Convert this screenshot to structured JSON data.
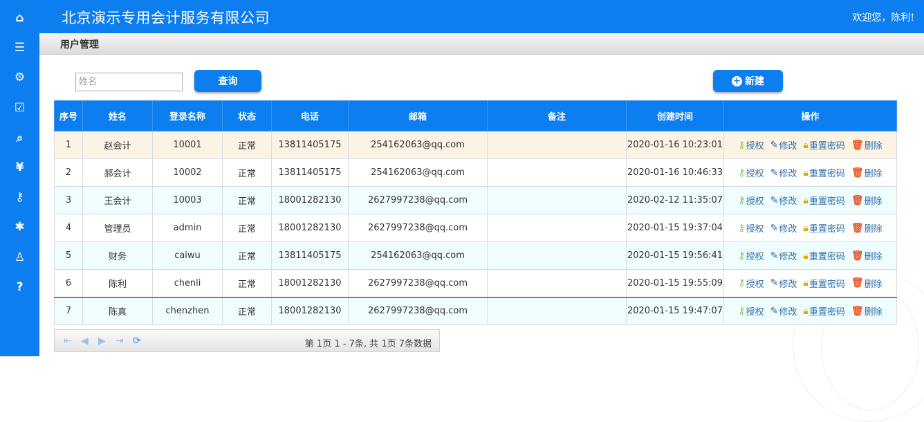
{
  "header": {
    "company": "北京演示专用会计服务有限公司",
    "welcome": "欢迎您，陈利!"
  },
  "sidebar": {
    "icons": [
      "home-icon",
      "list-icon",
      "gears-icon",
      "check-square-icon",
      "search-icon",
      "yen-icon",
      "key-icon",
      "gear-icon",
      "user-icon",
      "question-icon"
    ]
  },
  "breadcrumb": "用户管理",
  "search": {
    "placeholder": "姓名",
    "value": "",
    "button": "查询"
  },
  "toolbar": {
    "new_label": "新建"
  },
  "table": {
    "columns": [
      "序号",
      "姓名",
      "登录名称",
      "状态",
      "电话",
      "邮箱",
      "备注",
      "创建时间",
      "操作"
    ],
    "rows": [
      [
        "1",
        "赵会计",
        "10001",
        "正常",
        "13811405175",
        "254162063@qq.com",
        "",
        "2020-01-16 10:23:01"
      ],
      [
        "2",
        "郝会计",
        "10002",
        "正常",
        "13811405175",
        "254162063@qq.com",
        "",
        "2020-01-16 10:46:33"
      ],
      [
        "3",
        "王会计",
        "10003",
        "正常",
        "18001282130",
        "2627997238@qq.com",
        "",
        "2020-02-12 11:35:07"
      ],
      [
        "4",
        "管理员",
        "admin",
        "正常",
        "18001282130",
        "2627997238@qq.com",
        "",
        "2020-01-15 19:37:04"
      ],
      [
        "5",
        "财务",
        "caiwu",
        "正常",
        "13811405175",
        "254162063@qq.com",
        "",
        "2020-01-15 19:56:41"
      ],
      [
        "6",
        "陈利",
        "chenli",
        "正常",
        "18001282130",
        "2627997238@qq.com",
        "",
        "2020-01-15 19:55:09"
      ],
      [
        "7",
        "陈真",
        "chenzhen",
        "正常",
        "18001282130",
        "2627997238@qq.com",
        "",
        "2020-01-15 19:47:07"
      ]
    ],
    "actions": [
      "授权",
      "修改",
      "重置密码",
      "删除"
    ]
  },
  "pager": {
    "info": "第 1页 1 - 7条, 共 1页 7条数据"
  },
  "colors": {
    "primary": "#0c7ef0",
    "highlight_row": "#fbf3e4",
    "alt_row": "#effdfe",
    "link": "#2f6fae",
    "delete_icon": "#e65c2e"
  }
}
